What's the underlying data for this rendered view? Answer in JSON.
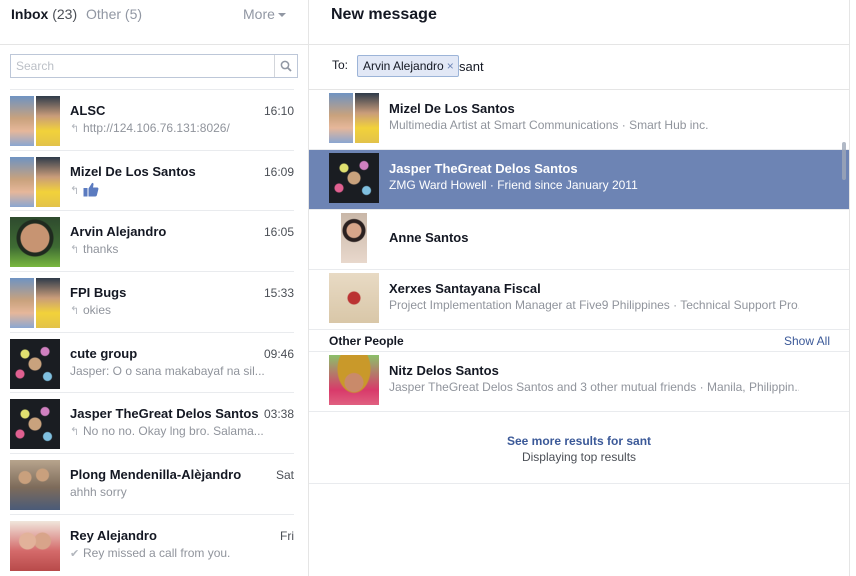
{
  "tabs": {
    "inbox_label": "Inbox",
    "inbox_count": "(23)",
    "other_label": "Other",
    "other_count": "(5)",
    "more_label": "More"
  },
  "search": {
    "placeholder": "Search"
  },
  "threads": [
    {
      "name": "ALSC",
      "time": "16:10",
      "snippet": "http://124.106.76.131:8026/",
      "glyph": "reply",
      "avatar": "group-two"
    },
    {
      "name": "Mizel De Los Santos",
      "time": "16:09",
      "snippet": "",
      "glyph": "reply-like",
      "avatar": "group-two"
    },
    {
      "name": "Arvin Alejandro",
      "time": "16:05",
      "snippet": "thanks",
      "glyph": "reply",
      "avatar": "person-green"
    },
    {
      "name": "FPI Bugs",
      "time": "15:33",
      "snippet": "okies",
      "glyph": "reply",
      "avatar": "group-two"
    },
    {
      "name": "cute group",
      "time": "09:46",
      "snippet": "Jasper: O o sana makabayaf na sil...",
      "glyph": "none",
      "avatar": "dark-dots"
    },
    {
      "name": "Jasper TheGreat Delos Santos",
      "time": "03:38",
      "snippet": "No no no. Okay lng bro. Salama...",
      "glyph": "reply",
      "avatar": "dark-dots"
    },
    {
      "name": "Plong Mendenilla-Alèjandro",
      "time": "Sat",
      "snippet": "ahhh sorry",
      "glyph": "none",
      "avatar": "family"
    },
    {
      "name": "Rey Alejandro",
      "time": "Fri",
      "snippet": "Rey missed a call from you.",
      "glyph": "check",
      "avatar": "couple"
    }
  ],
  "compose": {
    "title": "New message",
    "to_label": "To:",
    "token": "Arvin Alejandro",
    "token_remove": "×",
    "query": "sant"
  },
  "results": [
    {
      "name": "Mizel De Los Santos",
      "sub": "Multimedia Artist at Smart Communications · Smart Hub inc.",
      "selected": false,
      "avatar": "group-two"
    },
    {
      "name": "Jasper TheGreat Delos Santos",
      "sub": "ZMG Ward Howell · Friend since January 2011",
      "selected": true,
      "avatar": "dark-dots"
    },
    {
      "name": "Anne Santos",
      "sub": "",
      "selected": false,
      "avatar": "portrait"
    },
    {
      "name": "Xerxes Santayana Fiscal",
      "sub": "Project Implementation Manager at Five9 Philippines · Technical Support Pro...",
      "selected": false,
      "avatar": "beach"
    }
  ],
  "other_people": {
    "title": "Other People",
    "show_all": "Show All",
    "items": [
      {
        "name": "Nitz Delos Santos",
        "sub": "Jasper TheGreat Delos Santos and 3 other mutual friends · Manila, Philippin...",
        "avatar": "hat"
      }
    ]
  },
  "footer": {
    "see_more": "See more results for sant",
    "displaying": "Displaying top results"
  },
  "colors": {
    "selected_bg": "#6d84b4",
    "link": "#3b5998",
    "token_bg": "#e2e8f6"
  }
}
